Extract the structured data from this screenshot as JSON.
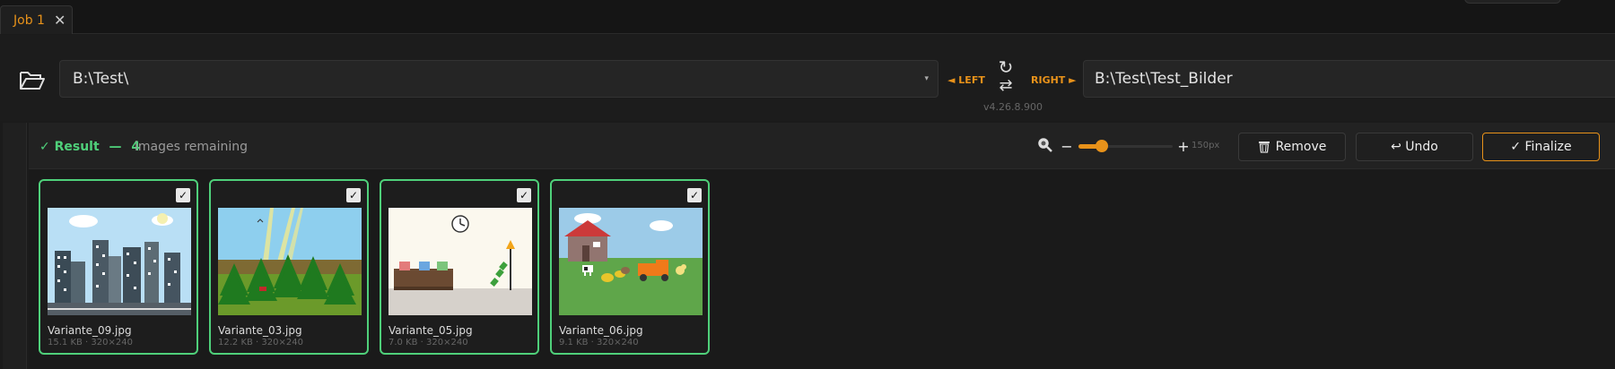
{
  "tab": {
    "label": "Job 1",
    "close_glyph": "✕"
  },
  "paths": {
    "left_value": "B:\\Test\\",
    "left_label": "◄ LEFT",
    "right_label": "RIGHT ►",
    "right_value": "B:\\Test\\Test_Bilder",
    "swap_top_glyph": "↻",
    "swap_bottom_glyph": "⇄",
    "version": "v4.26.8.900"
  },
  "toolbar": {
    "result_label": "✓ Result",
    "dash": "—",
    "count": "4",
    "remaining_label": "images remaining",
    "zoom_minus": "−",
    "zoom_plus": "+",
    "zoom_value_fraction": 0.25,
    "zoom_size": "150px",
    "remove_label": "Remove",
    "undo_label": "↩ Undo",
    "finalize_label": "✓ Finalize"
  },
  "images": [
    {
      "name": "Variante_09.jpg",
      "meta": "15.1 KB · 320×240",
      "checked": true
    },
    {
      "name": "Variante_03.jpg",
      "meta": "12.2 KB · 320×240",
      "checked": true
    },
    {
      "name": "Variante_05.jpg",
      "meta": "7.0 KB · 320×240",
      "checked": true
    },
    {
      "name": "Variante_06.jpg",
      "meta": "9.1 KB · 320×240",
      "checked": true
    }
  ],
  "colors": {
    "accent": "#e8921a",
    "success": "#4fd07a"
  }
}
